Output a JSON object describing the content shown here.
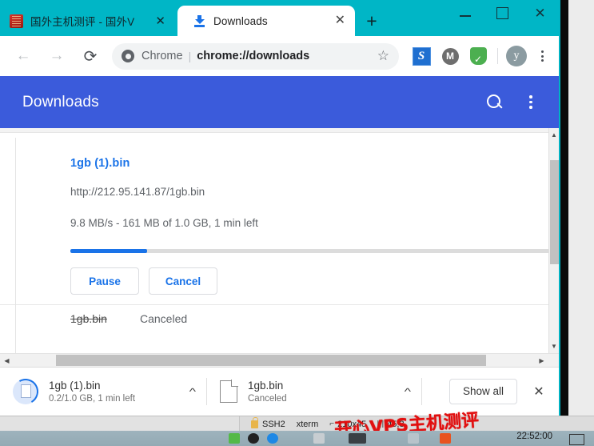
{
  "window": {
    "tabs": [
      {
        "title": "国外主机测评 - 国外V",
        "close": "✕",
        "favicon": "cn-site-favicon",
        "active": false
      },
      {
        "title": "Downloads",
        "close": "✕",
        "favicon": "download-icon",
        "active": true
      }
    ],
    "new_tab_label": "+",
    "controls": {
      "minimize": "—",
      "maximize": "□",
      "close": "✕"
    },
    "titlebar_color": "#00b6c6"
  },
  "toolbar": {
    "back_label": "←",
    "forward_label": "→",
    "reload_label": "⟳",
    "omnibox": {
      "scheme_label": "Chrome",
      "separator": "|",
      "url": "chrome://downloads"
    },
    "star_label": "☆",
    "extensions": [
      {
        "name": "s-extension-icon",
        "label": "S"
      },
      {
        "name": "m-extension-icon",
        "label": "M"
      },
      {
        "name": "adguard-shield-icon",
        "label": "✓"
      }
    ],
    "avatar_label": "y",
    "menu_label": "⋮"
  },
  "downloads_page": {
    "header_title": "Downloads",
    "header_color": "#3b5bdb",
    "search_icon": "search-icon",
    "menu_icon": "more-vertical-icon",
    "items": [
      {
        "filename": "1gb (1).bin",
        "url": "http://212.95.141.87/1gb.bin",
        "status": "9.8 MB/s - 161 MB of 1.0 GB, 1 min left",
        "progress_percent": 16,
        "progress_color": "#1a73e8",
        "buttons": [
          {
            "name": "pause-button",
            "label": "Pause"
          },
          {
            "name": "cancel-button",
            "label": "Cancel"
          }
        ]
      },
      {
        "filename": "1gb.bin",
        "status": "Canceled"
      }
    ],
    "scroll": {
      "v_up": "▲",
      "v_down": "▼",
      "h_left": "◀",
      "h_right": "▶"
    }
  },
  "download_shelf": {
    "items": [
      {
        "filename": "1gb (1).bin",
        "sub": "0.2/1.0 GB, 1 min left",
        "menu": "^",
        "icon": "file-progress-icon"
      },
      {
        "filename": "1gb.bin",
        "sub": "Canceled",
        "menu": "^",
        "icon": "file-icon"
      }
    ],
    "show_all_label": "Show all",
    "close_label": "✕"
  },
  "ssh_statusbar": {
    "connection": "SSH2",
    "terminal": "xterm",
    "size": "210x45",
    "position": "45,3"
  },
  "watermark": {
    "text": "开心VPS主机测评",
    "color": "#e10f0f"
  },
  "taskbar": {
    "clock": "22:52:00"
  }
}
